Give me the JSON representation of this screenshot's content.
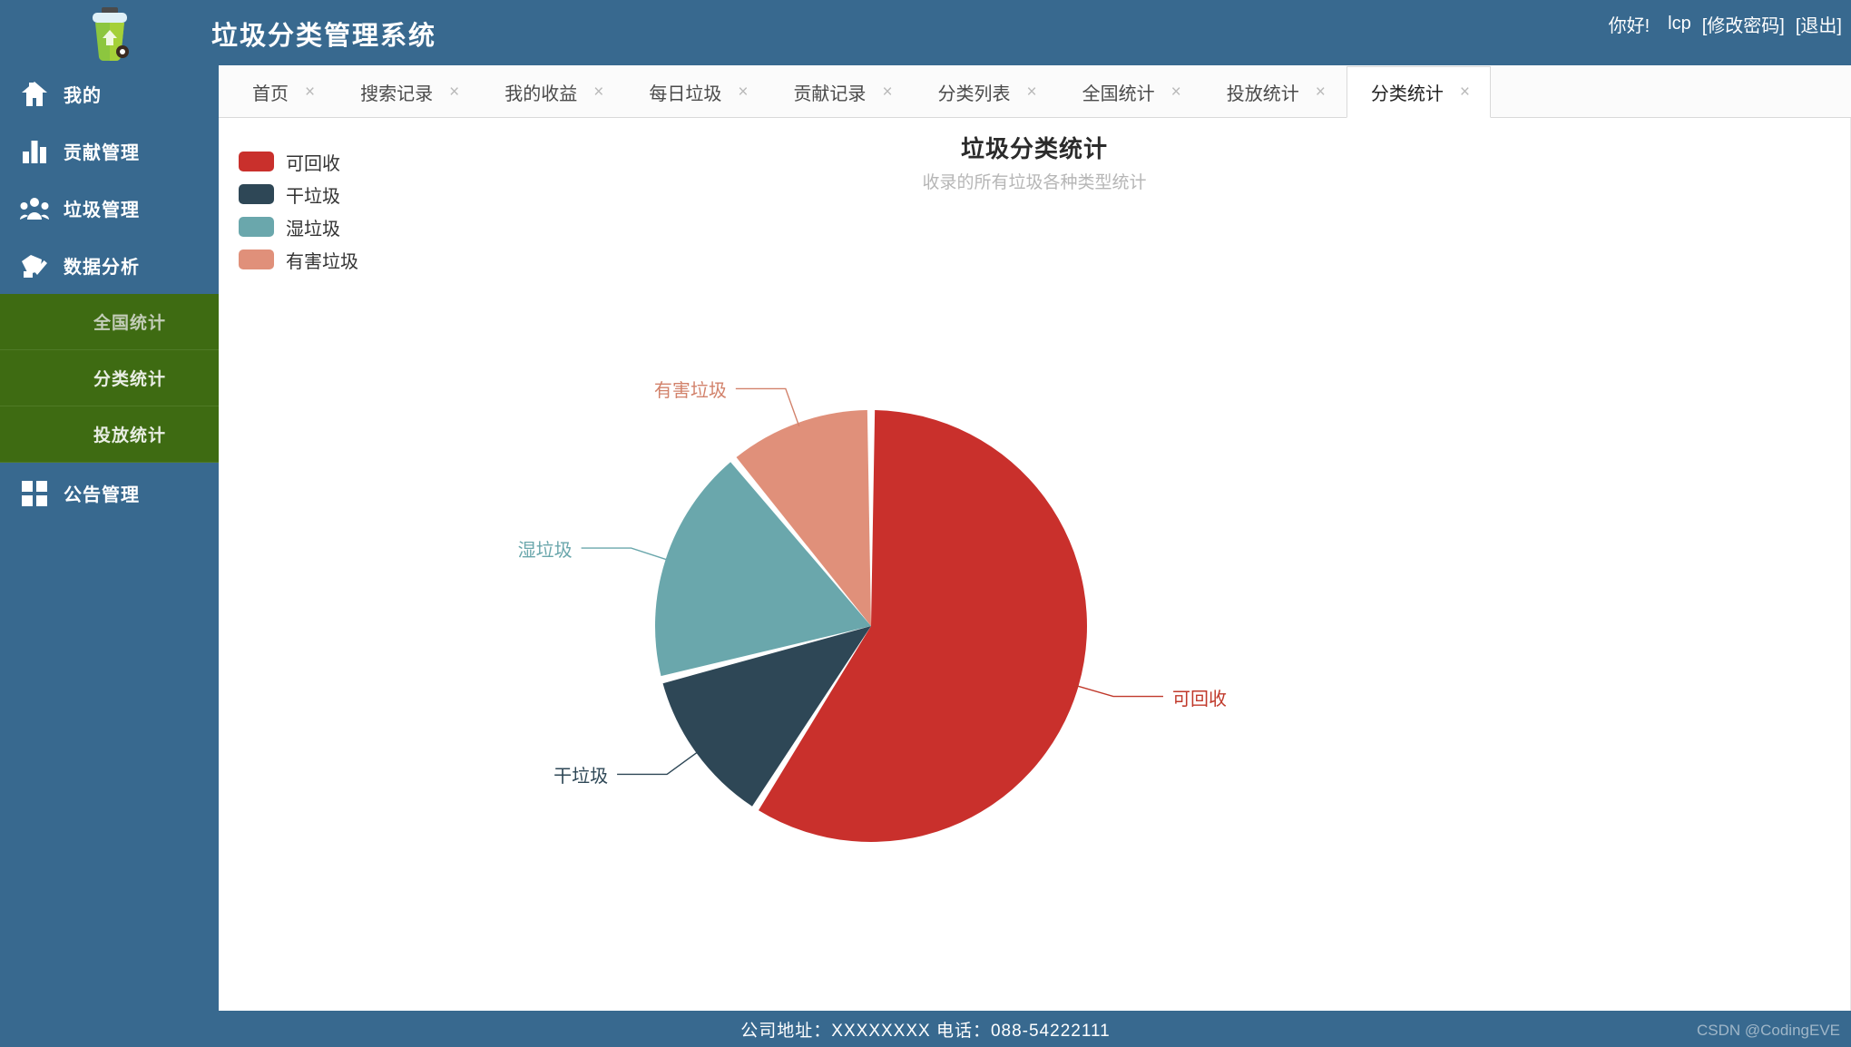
{
  "header": {
    "title": "垃圾分类管理系统",
    "greeting": "你好!",
    "username": "lcp",
    "change_password": "[修改密码]",
    "logout": "[退出]",
    "bg_color": "#38698f"
  },
  "sidebar": {
    "items": [
      {
        "label": "我的",
        "icon": "home-icon"
      },
      {
        "label": "贡献管理",
        "icon": "bar-chart-icon"
      },
      {
        "label": "垃圾管理",
        "icon": "users-icon"
      },
      {
        "label": "数据分析",
        "icon": "analysis-check-icon"
      }
    ],
    "subitems": [
      {
        "label": "全国统计",
        "active": false
      },
      {
        "label": "分类统计",
        "active": true
      },
      {
        "label": "投放统计",
        "active": false
      }
    ],
    "bottom_items": [
      {
        "label": "公告管理",
        "icon": "grid-icon"
      }
    ],
    "active_color": "#3e6b12",
    "logo_icon": "recycle-bin-icon"
  },
  "tabs": [
    {
      "label": "首页",
      "close": "×",
      "active": false
    },
    {
      "label": "搜索记录",
      "close": "×",
      "active": false
    },
    {
      "label": "我的收益",
      "close": "×",
      "active": false
    },
    {
      "label": "每日垃圾",
      "close": "×",
      "active": false
    },
    {
      "label": "贡献记录",
      "close": "×",
      "active": false
    },
    {
      "label": "分类列表",
      "close": "×",
      "active": false
    },
    {
      "label": "全国统计",
      "close": "×",
      "active": false
    },
    {
      "label": "投放统计",
      "close": "×",
      "active": false
    },
    {
      "label": "分类统计",
      "close": "×",
      "active": true
    }
  ],
  "footer": {
    "text": "公司地址：XXXXXXXX 电话：088-54222111",
    "watermark": "CSDN @CodingEVE"
  },
  "chart_data": {
    "type": "pie",
    "title": "垃圾分类统计",
    "subtitle": "收录的所有垃圾各种类型统计",
    "legend_position": "top-left",
    "categories": [
      "可回收",
      "干垃圾",
      "湿垃圾",
      "有害垃圾"
    ],
    "values": [
      59,
      12,
      18,
      11
    ],
    "colors": [
      "#c9302c",
      "#2e4756",
      "#6aa7ac",
      "#e0907a"
    ],
    "label_colors": [
      "#c0392b",
      "#2e4756",
      "#6aa7ac",
      "#d2826b"
    ],
    "start_angle": 0,
    "gap_degrees": 2,
    "labels": [
      {
        "text": "可回收",
        "side": "right"
      },
      {
        "text": "干垃圾",
        "side": "left"
      },
      {
        "text": "湿垃圾",
        "side": "left"
      },
      {
        "text": "有害垃圾",
        "side": "left"
      }
    ]
  }
}
